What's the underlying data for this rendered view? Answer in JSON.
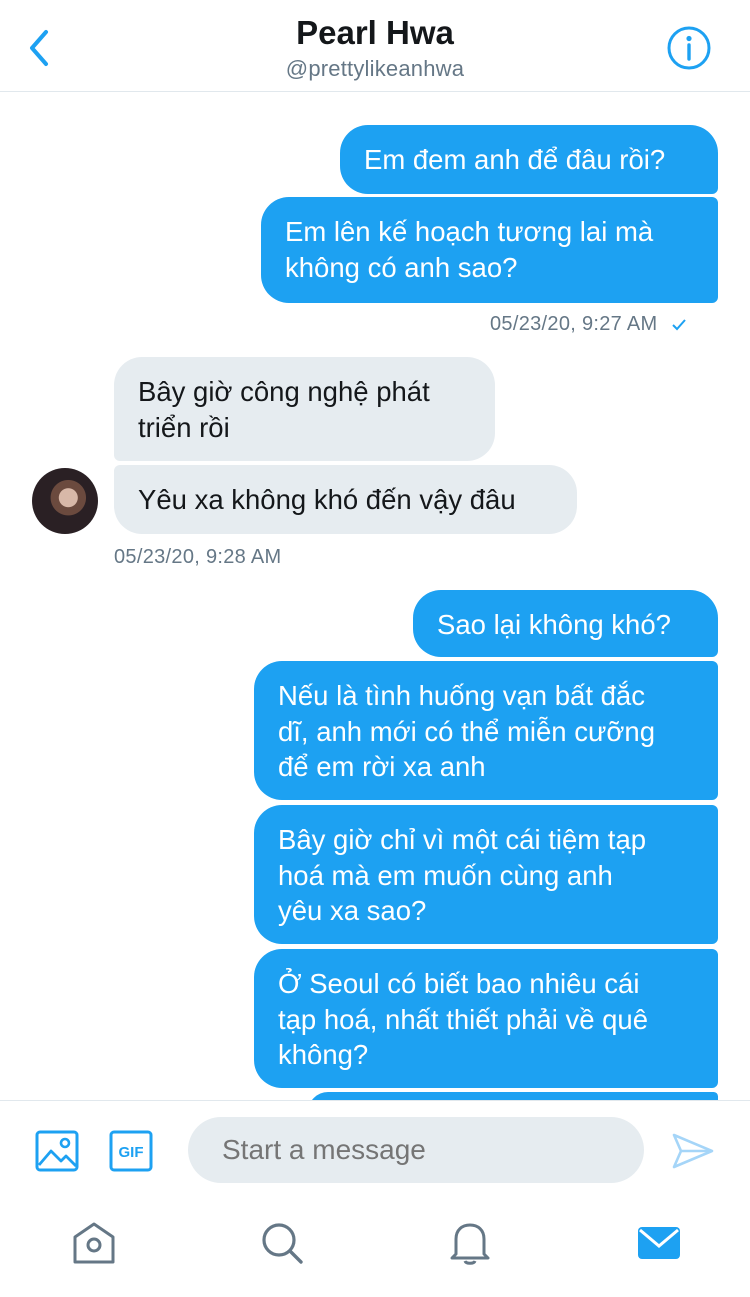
{
  "header": {
    "name": "Pearl Hwa",
    "handle": "@prettylikeanhwa"
  },
  "messages": {
    "m1": "Em đem anh để đâu rồi?",
    "m2_l1": "Em lên kế hoạch tương lai mà",
    "m2_l2": "không có anh sao?",
    "time1": "05/23/20, 9:27 AM",
    "r1_l1": "Bây giờ công nghệ phát",
    "r1_l2": "triển rồi",
    "r2": "Yêu xa không khó đến vậy đâu",
    "time2": "05/23/20, 9:28 AM",
    "m3": "Sao lại không khó?",
    "m4_l1": "Nếu là tình huống vạn bất đắc",
    "m4_l2": "dĩ, anh mới có thể miễn cưỡng",
    "m4_l3": "để em rời xa anh",
    "m5_l1": "Bây giờ chỉ vì một cái tiệm tạp",
    "m5_l2": "hoá mà em muốn cùng anh",
    "m5_l3": "yêu xa sao?",
    "m6_l1": "Ở Seoul có biết bao nhiêu cái",
    "m6_l2": "tạp hoá, nhất thiết phải về quê",
    "m6_l3": "không?"
  },
  "composer": {
    "placeholder": "Start a message",
    "gif_label": "GIF"
  },
  "icons": {
    "back": "chevron-left-icon",
    "info": "info-icon",
    "media": "image-icon",
    "gif": "gif-icon",
    "send": "send-icon",
    "home": "home-icon",
    "search": "search-icon",
    "notifications": "bell-icon",
    "messages": "mail-icon"
  },
  "colors": {
    "accent": "#1da1f2",
    "incoming_bubble": "#e6ecf0",
    "muted_text": "#657786"
  }
}
